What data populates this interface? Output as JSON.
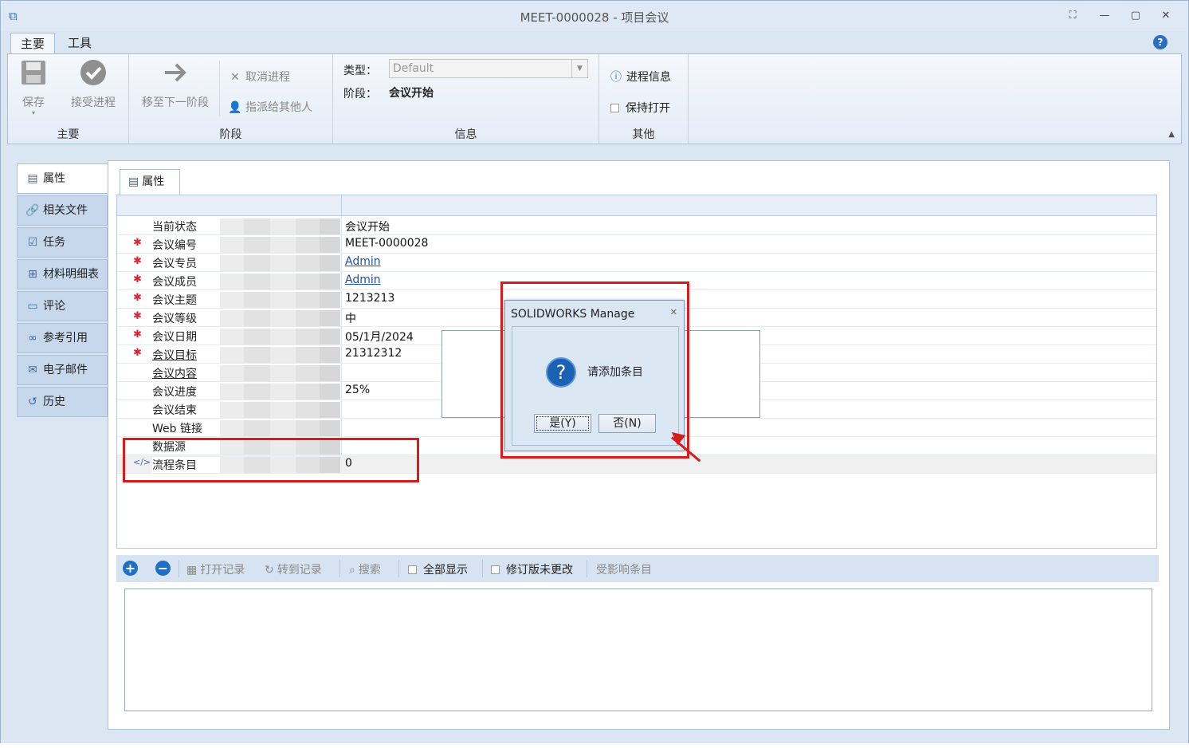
{
  "window": {
    "title": "MEET-0000028 - 项目会议",
    "controls": [
      "⛶",
      "—",
      "▢",
      "✕"
    ]
  },
  "ribbon_tabs": [
    {
      "label": "主要",
      "active": true
    },
    {
      "label": "工具",
      "active": false
    }
  ],
  "ribbon": {
    "main_group": {
      "label": "主要",
      "save": "保存",
      "accept": "接受进程"
    },
    "stage_group": {
      "label": "阶段",
      "next": "移至下一阶段",
      "cancel": "取消进程",
      "assign": "指派给其他人"
    },
    "info_group": {
      "label": "信息",
      "type_label": "类型：",
      "type_value": "Default",
      "stage_label": "阶段：",
      "stage_value": "会议开始"
    },
    "other_group": {
      "label": "其他",
      "progress_info": "进程信息",
      "keep_open": "保持打开"
    }
  },
  "sidenav": [
    {
      "label": "属性",
      "icon": "properties-icon",
      "glyph": "▤",
      "active": true
    },
    {
      "label": "相关文件",
      "icon": "paperclip-icon",
      "glyph": "🔗",
      "active": false
    },
    {
      "label": "任务",
      "icon": "task-icon",
      "glyph": "☑",
      "active": false
    },
    {
      "label": "材料明细表",
      "icon": "bom-icon",
      "glyph": "⊞",
      "active": false
    },
    {
      "label": "评论",
      "icon": "comment-icon",
      "glyph": "▭",
      "active": false
    },
    {
      "label": "参考引用",
      "icon": "link-icon",
      "glyph": "∞",
      "active": false
    },
    {
      "label": "电子邮件",
      "icon": "mail-icon",
      "glyph": "✉",
      "active": false
    },
    {
      "label": "历史",
      "icon": "history-icon",
      "glyph": "↺",
      "active": false
    }
  ],
  "content_tab": "属性",
  "properties": [
    {
      "name": "当前状态",
      "value": "会议开始",
      "required": false,
      "link": false,
      "underline": false
    },
    {
      "name": "会议编号",
      "value": "MEET-0000028",
      "required": true,
      "link": false,
      "underline": false
    },
    {
      "name": "会议专员",
      "value": "Admin",
      "required": true,
      "link": true,
      "underline": false
    },
    {
      "name": "会议成员",
      "value": "Admin",
      "required": true,
      "link": true,
      "underline": false
    },
    {
      "name": "会议主题",
      "value": "1213213",
      "required": true,
      "link": false,
      "underline": false
    },
    {
      "name": "会议等级",
      "value": "中",
      "required": true,
      "link": false,
      "underline": false
    },
    {
      "name": "会议日期",
      "value": "05/1月/2024",
      "required": true,
      "link": false,
      "underline": false
    },
    {
      "name": "会议目标",
      "value": "21312312",
      "required": true,
      "link": false,
      "underline": true
    },
    {
      "name": "会议内容",
      "value": "",
      "required": false,
      "link": false,
      "underline": true
    },
    {
      "name": "会议进度",
      "value": "25%",
      "required": false,
      "link": false,
      "underline": false
    },
    {
      "name": "会议结束",
      "value": "",
      "required": false,
      "link": false,
      "underline": false
    },
    {
      "name": "Web 链接",
      "value": "",
      "required": false,
      "link": false,
      "underline": false
    },
    {
      "name": "数据源",
      "value": "",
      "required": false,
      "link": false,
      "underline": false
    },
    {
      "name": "流程条目",
      "value": "0",
      "required": false,
      "link": false,
      "underline": false,
      "selected": true
    }
  ],
  "required_mark": "✱",
  "bottom_toolbar": {
    "open_record": "打开记录",
    "goto_record": "转到记录",
    "search": "搜索",
    "show_all": "全部显示",
    "revision_unchanged": "修订版未更改",
    "affected_items": "受影响条目"
  },
  "dialog": {
    "title": "SOLIDWORKS Manage",
    "message": "请添加条目",
    "yes": "是(Y)",
    "no": "否(N)"
  },
  "colors": {
    "accent": "#1d6fc8",
    "annotation": "#d81c1c",
    "ribbon_bg": "#e4ecf6"
  }
}
